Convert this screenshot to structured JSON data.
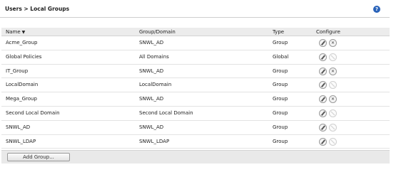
{
  "breadcrumb": "Users > Local Groups",
  "help_icon": "?",
  "table": {
    "headers": [
      "Name",
      "Group/Domain",
      "Type",
      "Configure"
    ],
    "sort_indicator": "▼",
    "rows": [
      {
        "name": "Acme_Group",
        "domain": "SNWL_AD",
        "type": "Group",
        "deletable": true
      },
      {
        "name": "Global Policies",
        "domain": "All Domains",
        "type": "Global",
        "deletable": false
      },
      {
        "name": "IT_Group",
        "domain": "SNWL_AD",
        "type": "Group",
        "deletable": true
      },
      {
        "name": "LocalDomain",
        "domain": "LocalDomain",
        "type": "Group",
        "deletable": false
      },
      {
        "name": "Mega_Group",
        "domain": "SNWL_AD",
        "type": "Group",
        "deletable": true
      },
      {
        "name": "Second Local Domain",
        "domain": "Second Local Domain",
        "type": "Group",
        "deletable": false
      },
      {
        "name": "SNWL_AD",
        "domain": "SNWL_AD",
        "type": "Group",
        "deletable": false
      },
      {
        "name": "SNWL_LDAP",
        "domain": "SNWL_LDAP",
        "type": "Group",
        "deletable": false
      }
    ]
  },
  "footer": {
    "add_label": "Add Group..."
  }
}
